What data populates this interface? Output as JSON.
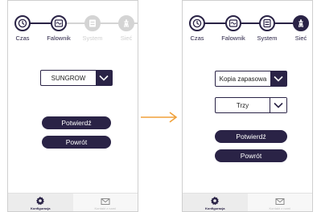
{
  "colors": {
    "primary": "#2a2346",
    "muted": "#d4d4d4",
    "accent_arrow": "#f0a13a"
  },
  "left_screen": {
    "steps": [
      {
        "label": "Czas",
        "icon": "clock-icon",
        "state": "done"
      },
      {
        "label": "Falownik",
        "icon": "inverter-wave-icon",
        "state": "done"
      },
      {
        "label": "System",
        "icon": "system-list-icon",
        "state": "inactive"
      },
      {
        "label": "Sieć",
        "icon": "grid-tower-icon",
        "state": "inactive"
      }
    ],
    "select": {
      "value": "SUNGROW"
    },
    "buttons": {
      "confirm": "Potwierdź",
      "back": "Powrót"
    },
    "tabs": [
      {
        "label": "Konfiguracja",
        "icon": "gear-icon",
        "active": true
      },
      {
        "label": "Kontakt z nami",
        "icon": "mail-icon",
        "active": false
      }
    ]
  },
  "right_screen": {
    "steps": [
      {
        "label": "Czas",
        "icon": "clock-icon",
        "state": "done"
      },
      {
        "label": "Falownik",
        "icon": "inverter-wave-icon",
        "state": "done"
      },
      {
        "label": "System",
        "icon": "system-list-icon",
        "state": "done"
      },
      {
        "label": "Sieć",
        "icon": "grid-tower-icon",
        "state": "current"
      }
    ],
    "select_mode": {
      "value": "Kopia zapasowa"
    },
    "select_count": {
      "value": "Trzy"
    },
    "buttons": {
      "confirm": "Potwierdź",
      "back": "Powrót"
    },
    "tabs": [
      {
        "label": "Konfiguracja",
        "icon": "gear-icon",
        "active": true
      },
      {
        "label": "Kontakt z nami",
        "icon": "mail-icon",
        "active": false
      }
    ]
  },
  "transition_arrow": {
    "icon": "arrow-right-icon"
  }
}
